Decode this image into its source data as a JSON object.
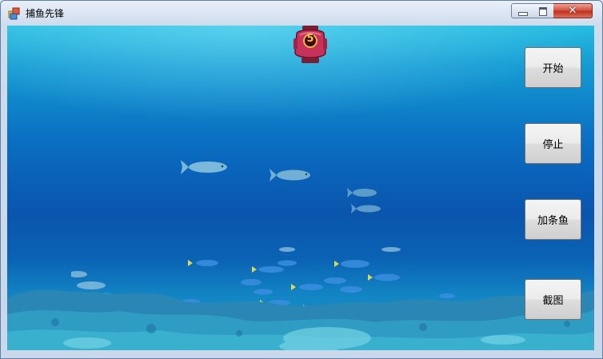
{
  "window": {
    "title": "捕鱼先锋",
    "close_glyph": "✕"
  },
  "lantern": {
    "number": "5"
  },
  "buttons": {
    "start": "开始",
    "stop": "停止",
    "add_fish": "加条鱼",
    "screenshot": "截图"
  },
  "icons": {
    "app": "app-window-icon",
    "minimize": "minimize-icon",
    "maximize": "maximize-icon",
    "close": "close-icon"
  }
}
